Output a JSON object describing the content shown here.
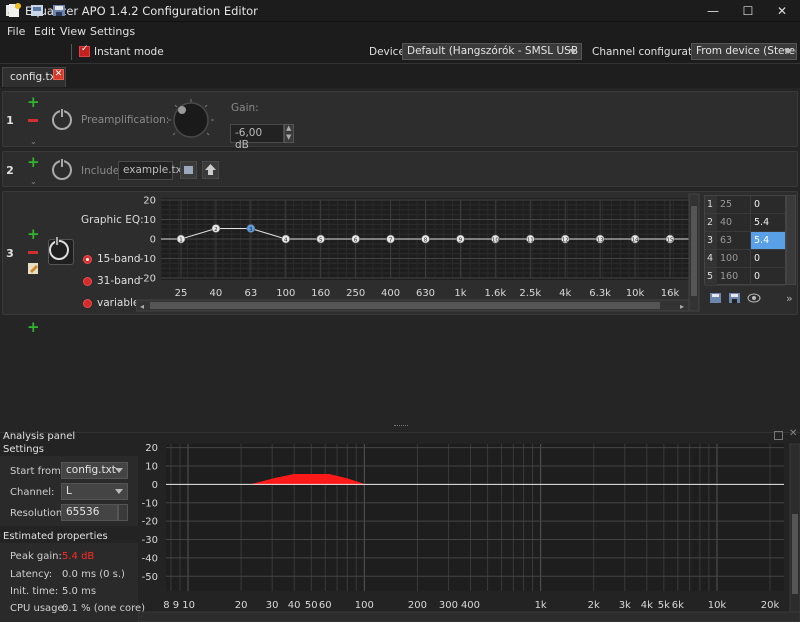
{
  "window": {
    "title": "Equalizer APO 1.4.2 Configuration Editor",
    "minimize": "—",
    "maximize": "☐",
    "close": "✕"
  },
  "menu": [
    "File",
    "Edit",
    "View",
    "Settings"
  ],
  "toolbar": {
    "instant_mode_label": "Instant mode",
    "device_label": "Device:",
    "device_value": "Default (Hangszórók - SMSL USB DAC)",
    "channel_config_label": "Channel configuration:",
    "channel_config_value": "From device (Stereo)"
  },
  "tab": {
    "label": "config.txt",
    "close": "✕"
  },
  "filters": {
    "row1": {
      "number": "1",
      "label": "Preamplification:",
      "gain_label": "Gain:",
      "gain_value": "-6,00 dB"
    },
    "row2": {
      "number": "2",
      "label": "Include:",
      "file_value": "example.txt"
    },
    "row3": {
      "number": "3",
      "label": "Graphic EQ:",
      "radios": [
        "15-band",
        "31-band",
        "variable"
      ],
      "selected_radio": "15-band"
    },
    "add_plus": "+"
  },
  "eq_chart": {
    "yticks": [
      "20",
      "10",
      "0",
      "-10",
      "-20"
    ],
    "xlabels": [
      "25",
      "40",
      "63",
      "100",
      "160",
      "250",
      "400",
      "630",
      "1k",
      "1.6k",
      "2.5k",
      "4k",
      "6.3k",
      "10k",
      "16k"
    ],
    "point_labels": [
      "1",
      "2",
      "3",
      "4",
      "5",
      "6",
      "7",
      "8",
      "9",
      "10",
      "11",
      "12",
      "13",
      "14",
      "15"
    ]
  },
  "chart_data": {
    "type": "line",
    "x": [
      25,
      40,
      63,
      100,
      160,
      250,
      400,
      630,
      1000,
      1600,
      2500,
      4000,
      6300,
      10000,
      16000
    ],
    "series": [
      {
        "values": [
          0,
          5.4,
          5.4,
          0,
          0,
          0,
          0,
          0,
          0,
          0,
          0,
          0,
          0,
          0,
          0
        ]
      }
    ],
    "ylim": [
      -20,
      20
    ],
    "selected_index": 2
  },
  "table": {
    "rows": [
      {
        "idx": "1",
        "freq": "25",
        "gain": "0"
      },
      {
        "idx": "2",
        "freq": "40",
        "gain": "5.4"
      },
      {
        "idx": "3",
        "freq": "63",
        "gain": "5.4"
      },
      {
        "idx": "4",
        "freq": "100",
        "gain": "0"
      },
      {
        "idx": "5",
        "freq": "160",
        "gain": "0"
      }
    ],
    "selected_row": 2,
    "more": "»"
  },
  "analysis": {
    "title": "Analysis panel",
    "settings_title": "Settings",
    "start_from_label": "Start from:",
    "start_from_value": "config.txt",
    "channel_label": "Channel:",
    "channel_value": "L",
    "resolution_label": "Resolution:",
    "resolution_value": "65536",
    "estimated_title": "Estimated properties",
    "peak_gain_label": "Peak gain:",
    "peak_gain_value": "5.4 dB",
    "latency_label": "Latency:",
    "latency_value": "0.0 ms (0 s.)",
    "init_label": "Init. time:",
    "init_value": "5.0 ms",
    "cpu_label": "CPU usage:",
    "cpu_value": "0.1 % (one core)",
    "yticks": [
      "20",
      "10",
      "0",
      "-10",
      "-20",
      "-30",
      "-40",
      "-50"
    ],
    "xticks": [
      {
        "label": "8 9 10"
      },
      {
        "label": "20"
      },
      {
        "label": "30"
      },
      {
        "label": "40"
      },
      {
        "label": "50"
      },
      {
        "label": "60"
      },
      {
        "label": "100"
      },
      {
        "label": "200"
      },
      {
        "label": "300"
      },
      {
        "label": "400"
      },
      {
        "label": "1k"
      },
      {
        "label": "2k"
      },
      {
        "label": "3k"
      },
      {
        "label": "4k"
      },
      {
        "label": "5k"
      },
      {
        "label": "6k"
      },
      {
        "label": "10k"
      },
      {
        "label": "20k"
      }
    ]
  },
  "colors": {
    "accent_red": "#ff1a1a",
    "selected_blue": "#5aa0e6",
    "plus_green": "#2fb52f"
  }
}
